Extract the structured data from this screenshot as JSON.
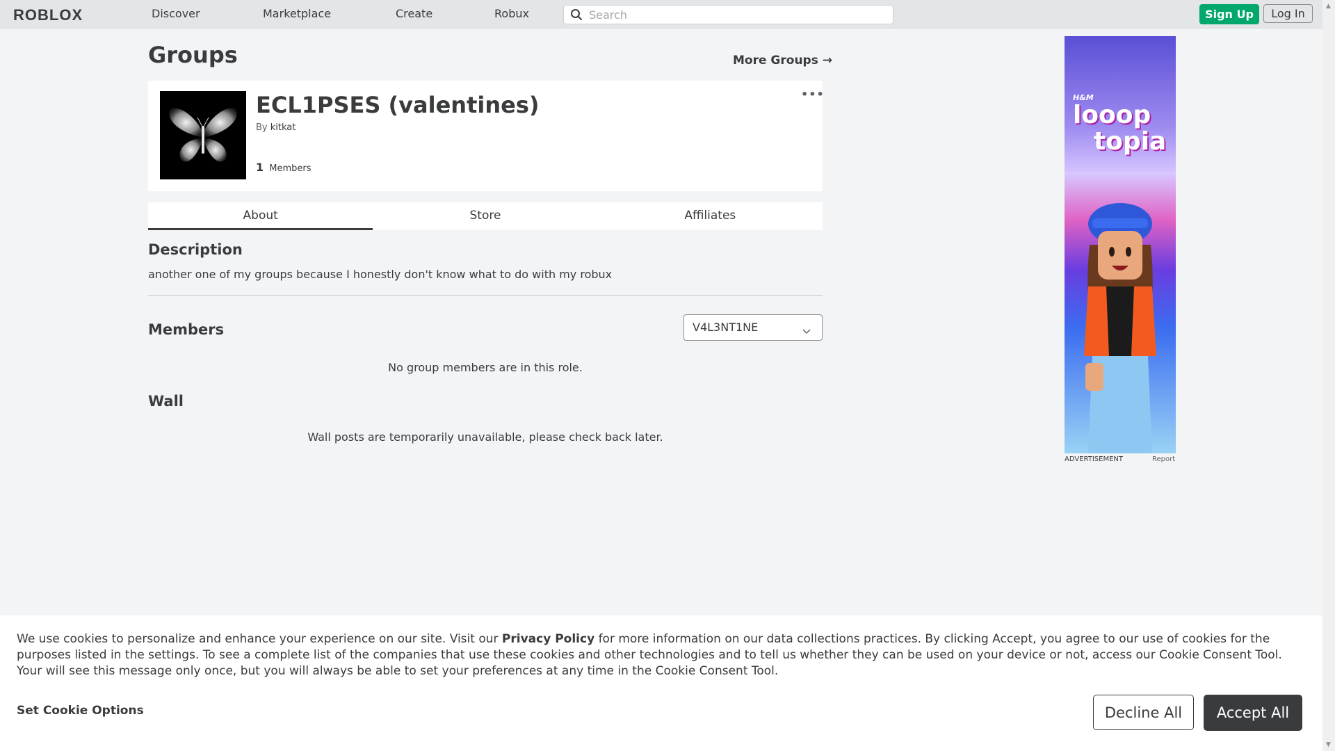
{
  "header": {
    "logo": "ROBLOX",
    "nav": [
      "Discover",
      "Marketplace",
      "Create",
      "Robux"
    ],
    "search_placeholder": "Search",
    "signup_label": "Sign Up",
    "login_label": "Log In"
  },
  "page": {
    "title": "Groups",
    "more_groups_label": "More Groups →"
  },
  "group": {
    "name": "ECL1PSES (valentines)",
    "by_label": "By",
    "owner": "kitkat",
    "member_count": "1",
    "members_label": "Members",
    "more_menu": "•••",
    "thumbnail_icon": "butterfly-icon"
  },
  "tabs": [
    {
      "label": "About",
      "active": true
    },
    {
      "label": "Store",
      "active": false
    },
    {
      "label": "Affiliates",
      "active": false
    }
  ],
  "description": {
    "heading": "Description",
    "text": "another one of my groups because I honestly don't know what to do with my robux"
  },
  "members": {
    "heading": "Members",
    "selected_role": "V4L3NT1NE",
    "empty_message": "No group members are in this role."
  },
  "wall": {
    "heading": "Wall",
    "message": "Wall posts are temporarily unavailable, please check back later."
  },
  "ad": {
    "brand": "H&M",
    "title_line1": "looop",
    "title_line2": "topia",
    "label": "ADVERTISEMENT",
    "report": "Report"
  },
  "cookie": {
    "text_before": "We use cookies to personalize and enhance your experience on our site. Visit our ",
    "privacy_link": "Privacy Policy",
    "text_after": " for more information on our data collections practices. By clicking Accept, you agree to our use of cookies for the purposes listed in the settings. To see a complete list of the companies that use these cookies and other technologies and to tell us whether they can be used on your device or not, access our Cookie Consent Tool. Your will see this message only once, but you will always be able to set your preferences at any time in the Cookie Consent Tool.",
    "options_label": "Set Cookie Options",
    "decline_label": "Decline All",
    "accept_label": "Accept All"
  },
  "colors": {
    "accent_green": "#00a86b",
    "text": "#393b3d",
    "background": "#f2f4f5"
  }
}
